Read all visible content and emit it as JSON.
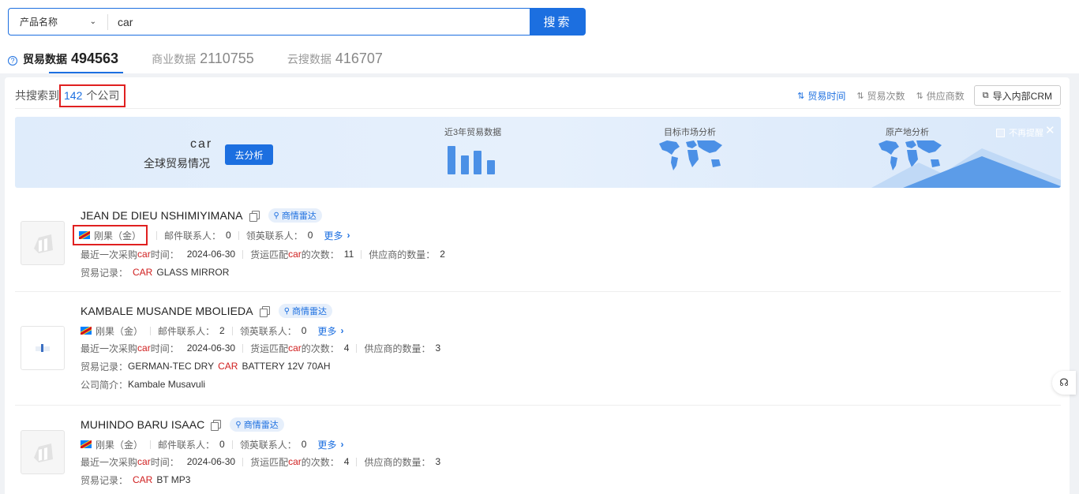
{
  "search": {
    "field_select": "产品名称",
    "keyword": "car",
    "button": "搜索"
  },
  "tabs": [
    {
      "label": "贸易数据",
      "count": "494563",
      "active": true
    },
    {
      "label": "商业数据",
      "count": "2110755",
      "active": false
    },
    {
      "label": "云搜数据",
      "count": "416707",
      "active": false
    }
  ],
  "results": {
    "prefix": "共搜索到",
    "count": "142",
    "suffix": "个公司",
    "sorts": [
      {
        "label": "贸易时间",
        "active": true
      },
      {
        "label": "贸易次数",
        "active": false
      },
      {
        "label": "供应商数",
        "active": false
      }
    ],
    "crm_button": "导入内部CRM"
  },
  "banner": {
    "keyword": "car",
    "subtitle": "全球贸易情况",
    "button": "去分析",
    "sec1": "近3年贸易数据",
    "sec2": "目标市场分析",
    "sec3": "原产地分析",
    "dont_remind": "不再提醒",
    "bar_values": [
      0.9,
      0.6,
      0.75,
      0.45
    ]
  },
  "labels": {
    "email_contacts": "邮件联系人：",
    "linkedin_contacts": "领英联系人：",
    "more": "更多",
    "last_purchase_a": "最近一次采购",
    "last_purchase_b": "时间：",
    "match_a": "货运匹配",
    "match_b": "的次数：",
    "suppliers": "供应商的数量：",
    "trade_record": "贸易记录：",
    "intro": "公司简介："
  },
  "companies": [
    {
      "name": "JEAN DE DIEU NSHIMIYIMANA",
      "radar": "商情雷达",
      "country": "刚果（金）",
      "email_contacts": "0",
      "linkedin_contacts": "0",
      "keyword": "car",
      "last_purchase": "2024-06-30",
      "match_count": "11",
      "supplier_count": "2",
      "record_pre": "",
      "record_kw": "CAR",
      "record_post": "GLASS MIRROR"
    },
    {
      "name": "KAMBALE MUSANDE MBOLIEDA",
      "radar": "商情雷达",
      "country": "刚果（金）",
      "email_contacts": "2",
      "linkedin_contacts": "0",
      "keyword": "car",
      "last_purchase": "2024-06-30",
      "match_count": "4",
      "supplier_count": "3",
      "record_pre": "GERMAN-TEC DRY",
      "record_kw": "CAR",
      "record_post": "BATTERY 12V 70AH",
      "intro": "Kambale Musavuli"
    },
    {
      "name": "MUHINDO BARU ISAAC",
      "radar": "商情雷达",
      "country": "刚果（金）",
      "email_contacts": "0",
      "linkedin_contacts": "0",
      "keyword": "car",
      "last_purchase": "2024-06-30",
      "match_count": "4",
      "supplier_count": "3",
      "record_pre": "",
      "record_kw": "CAR",
      "record_post": "BT MP3"
    }
  ],
  "colors": {
    "primary": "#1c6fe0",
    "highlight_border": "#e02020",
    "keyword_red": "#d01f1f"
  }
}
